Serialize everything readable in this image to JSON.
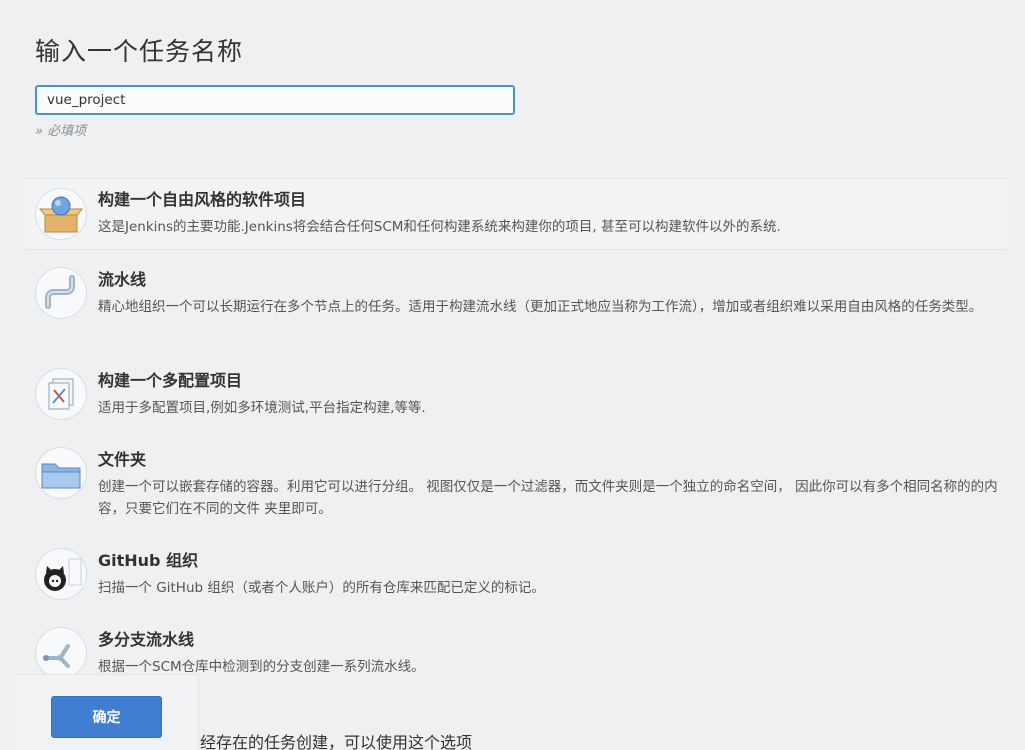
{
  "header": {
    "title": "输入一个任务名称"
  },
  "name_field": {
    "value": "vue_project",
    "required_hint": "» 必填项"
  },
  "job_types": [
    {
      "name": "构建一个自由风格的软件项目",
      "description": "这是Jenkins的主要功能.Jenkins将会结合任何SCM和任何构建系统来构建你的项目, 甚至可以构建软件以外的系统.",
      "icon": "freestyle-project-icon"
    },
    {
      "name": "流水线",
      "description": "精心地组织一个可以长期运行在多个节点上的任务。适用于构建流水线（更加正式地应当称为工作流），增加或者组织难以采用自由风格的任务类型。",
      "icon": "pipeline-icon"
    },
    {
      "name": "构建一个多配置项目",
      "description": "适用于多配置项目,例如多环境测试,平台指定构建,等等.",
      "icon": "multi-config-project-icon"
    },
    {
      "name": "文件夹",
      "description": "创建一个可以嵌套存储的容器。利用它可以进行分组。 视图仅仅是一个过滤器，而文件夹则是一个独立的命名空间， 因此你可以有多个相同名称的的内容，只要它们在不同的文件 夹里即可。",
      "icon": "folder-icon"
    },
    {
      "name": "GitHub 组织",
      "description": "扫描一个 GitHub 组织（或者个人账户）的所有仓库来匹配已定义的标记。",
      "icon": "github-organization-icon"
    },
    {
      "name": "多分支流水线",
      "description": "根据一个SCM仓库中检测到的分支创建一系列流水线。",
      "icon": "multibranch-pipeline-icon"
    }
  ],
  "footer": {
    "ok_label": "确定",
    "copy_hint": "经存在的任务创建，可以使用这个选项"
  },
  "colors": {
    "accent": "#3f7ed1",
    "background": "#eef0f1"
  }
}
